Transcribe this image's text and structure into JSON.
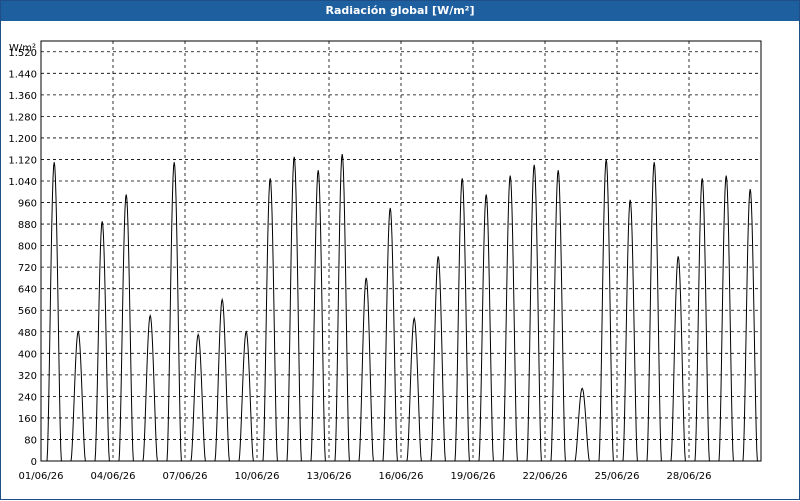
{
  "window": {
    "title": "Radiación global [W/m²]"
  },
  "chart_data": {
    "type": "line",
    "title": "Radiación global [W/m²]",
    "ylabel": "W/m²",
    "ylim": [
      0,
      1560
    ],
    "yticks": [
      "0",
      "80",
      "160",
      "240",
      "320",
      "400",
      "480",
      "560",
      "640",
      "720",
      "800",
      "880",
      "960",
      "1.040",
      "1.120",
      "1.200",
      "1.280",
      "1.360",
      "1.440",
      "1.520"
    ],
    "xlim_days": [
      1,
      31
    ],
    "xticks": [
      "01/06/26",
      "04/06/26",
      "07/06/26",
      "10/06/26",
      "13/06/26",
      "16/06/26",
      "19/06/26",
      "22/06/26",
      "25/06/26",
      "28/06/26"
    ],
    "grid": true,
    "series": [
      {
        "daily_peaks": [
          1110,
          480,
          890,
          990,
          540,
          1110,
          470,
          600,
          480,
          1050,
          1130,
          1080,
          1140,
          680,
          940,
          530,
          760,
          1050,
          990,
          1060,
          1100,
          1080,
          270,
          1120,
          970,
          1110,
          760,
          1050,
          1060,
          1010
        ],
        "color": "#000000"
      }
    ]
  }
}
